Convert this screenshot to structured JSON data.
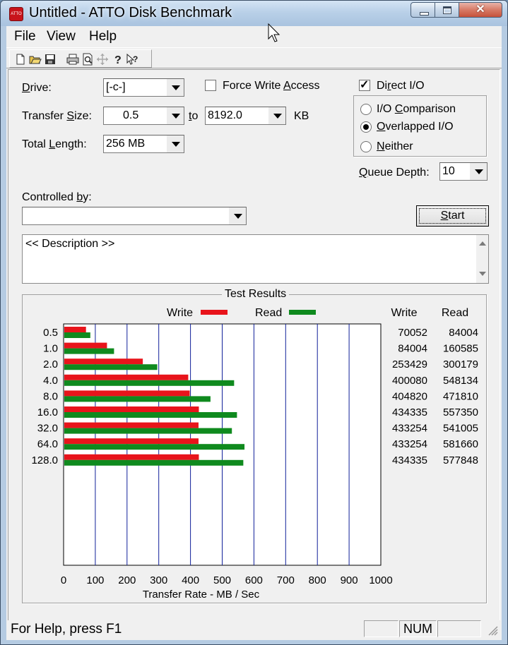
{
  "window": {
    "title": "Untitled - ATTO Disk Benchmark",
    "close_glyph": "✕",
    "app_icon_text": "ATTO"
  },
  "menu": [
    "File",
    "View",
    "Help"
  ],
  "toolbar_icons": [
    "new-document-icon",
    "open-folder-icon",
    "save-icon",
    "print-icon",
    "print-preview-icon",
    "move-icon",
    "help-icon",
    "context-help-icon"
  ],
  "form": {
    "drive_label": {
      "pre": "",
      "key": "D",
      "post": "rive:"
    },
    "drive_value": "[-c-]",
    "force_write_label": {
      "pre": "Force Write ",
      "key": "A",
      "post": "ccess"
    },
    "force_write_checked": false,
    "direct_io_label": {
      "pre": "Di",
      "key": "r",
      "post": "ect I/O"
    },
    "direct_io_checked": true,
    "transfer_size_label": {
      "pre": "Transfer ",
      "key": "S",
      "post": "ize:"
    },
    "transfer_from": "0.5",
    "to_label": {
      "pre": "",
      "key": "t",
      "post": "o"
    },
    "transfer_to": "8192.0",
    "kb_label": "KB",
    "total_length_label": {
      "pre": "Total ",
      "key": "L",
      "post": "ength:"
    },
    "total_length_value": "256 MB",
    "io_comparison_label": {
      "pre": "I/O ",
      "key": "C",
      "post": "omparison"
    },
    "overlapped_io_label": {
      "pre": "",
      "key": "O",
      "post": "verlapped I/O"
    },
    "neither_label": {
      "pre": "",
      "key": "N",
      "post": "either"
    },
    "selected_mode": "Overlapped I/O",
    "queue_depth_label": {
      "pre": "",
      "key": "Q",
      "post": "ueue Depth:"
    },
    "queue_depth_value": "10",
    "controlled_by_label": {
      "pre": "Controlled ",
      "key": "b",
      "post": "y:"
    },
    "controlled_by_value": "",
    "start_label": {
      "pre": "",
      "key": "S",
      "post": "tart"
    },
    "description": "<< Description >>"
  },
  "chart_data": {
    "type": "bar",
    "title": "Test Results",
    "orientation": "horizontal",
    "categories": [
      "0.5",
      "1.0",
      "2.0",
      "4.0",
      "8.0",
      "16.0",
      "32.0",
      "64.0",
      "128.0"
    ],
    "series": [
      {
        "name": "Write",
        "color": "#e8141b",
        "values": [
          68.4,
          134.6,
          247.5,
          390.7,
          395.3,
          424.2,
          423.1,
          423.1,
          424.2
        ]
      },
      {
        "name": "Read",
        "color": "#0f8a1e",
        "values": [
          82.0,
          156.8,
          293.1,
          535.3,
          460.8,
          544.3,
          528.3,
          568.0,
          564.3
        ]
      }
    ],
    "table": {
      "headers": [
        "Write",
        "Read"
      ],
      "write": [
        "70052",
        "84004",
        "253429",
        "400080",
        "404820",
        "434335",
        "433254",
        "433254",
        "434335"
      ],
      "read": [
        "84004",
        "160585",
        "300179",
        "548134",
        "471810",
        "557350",
        "541005",
        "581660",
        "577848"
      ]
    },
    "xlabel": "Transfer Rate - MB / Sec",
    "xticks": [
      0,
      100,
      200,
      300,
      400,
      500,
      600,
      700,
      800,
      900,
      1000
    ],
    "xlim": [
      0,
      1000
    ],
    "grid": true,
    "legend_position": "top"
  },
  "status": {
    "help_text": "For Help, press F1",
    "caps": "",
    "num": "NUM",
    "scrl": ""
  }
}
